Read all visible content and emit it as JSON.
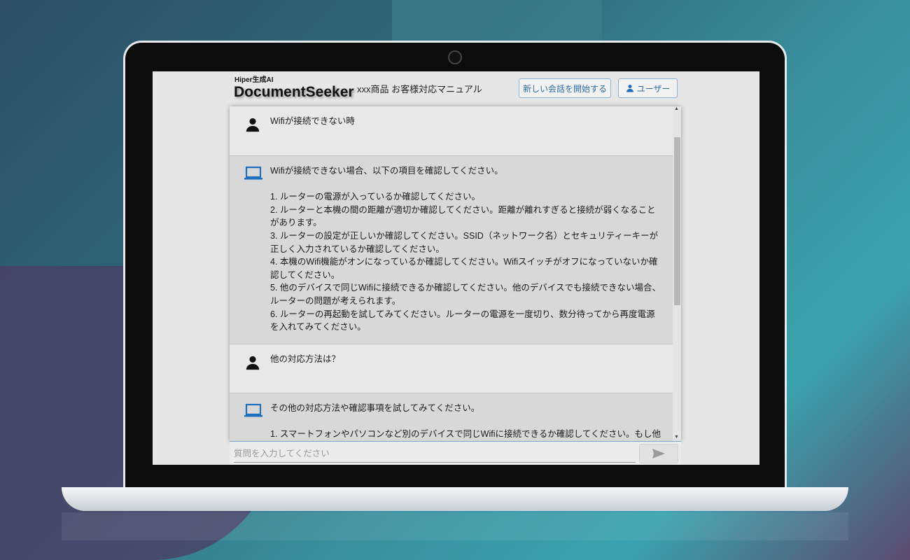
{
  "header": {
    "brand_sub": "Hiper生成AI",
    "brand": "DocumentSeeker",
    "manual_title": "xxx商品 お客様対応マニュアル",
    "new_chat_label": "新しい会話を開始する",
    "user_label": "ユーザー"
  },
  "colors": {
    "accent": "#1f6fbf",
    "ai_bg": "#d8d8d8",
    "user_bg": "#e8e8e8"
  },
  "messages": [
    {
      "role": "user",
      "icon": "person-icon",
      "lines": [
        "Wifiが接続できない時"
      ]
    },
    {
      "role": "ai",
      "icon": "laptop-icon",
      "lines": [
        "Wifiが接続できない場合、以下の項目を確認してください。",
        "",
        "1. ルーターの電源が入っているか確認してください。",
        "2. ルーターと本機の間の距離が適切か確認してください。距離が離れすぎると接続が弱くなることがあります。",
        "3. ルーターの設定が正しいか確認してください。SSID（ネットワーク名）とセキュリティーキーが正しく入力されているか確認してください。",
        "4. 本機のWifi機能がオンになっているか確認してください。Wifiスイッチがオフになっていないか確認してください。",
        "5. 他のデバイスで同じWifiに接続できるか確認してください。他のデバイスでも接続できない場合、ルーターの問題が考えられます。",
        "6. ルーターの再起動を試してみてください。ルーターの電源を一度切り、数分待ってから再度電源を入れてみてください。"
      ]
    },
    {
      "role": "user",
      "icon": "person-icon",
      "lines": [
        "他の対応方法は？"
      ]
    },
    {
      "role": "ai",
      "icon": "laptop-icon",
      "lines": [
        "その他の対応方法や確認事項を試してみてください。",
        "",
        "1. スマートフォンやパソコンなど別のデバイスで同じWifiに接続できるか確認してください。もし他の"
      ]
    }
  ],
  "input": {
    "placeholder": "質問を入力してください",
    "value": ""
  }
}
